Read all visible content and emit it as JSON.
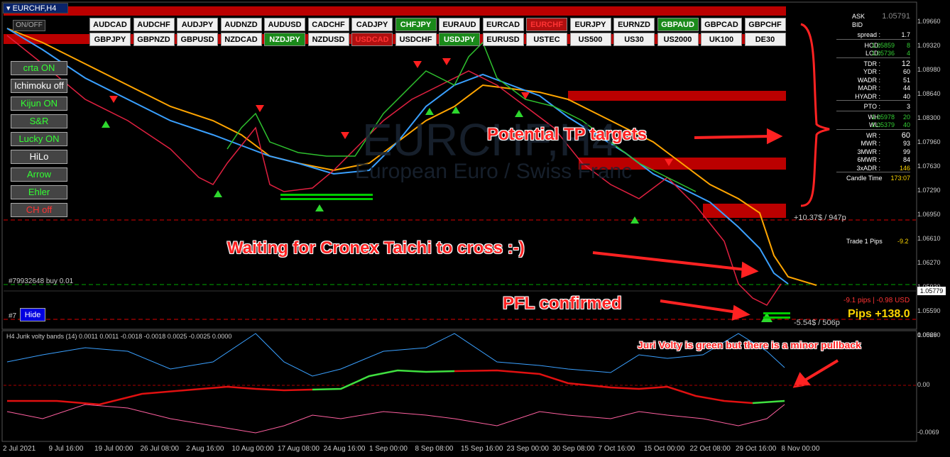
{
  "window": {
    "title": "EURCHF,H4",
    "onoff": "ON/OFF"
  },
  "symbols_row1": [
    {
      "label": "AUDCAD",
      "state": "normal"
    },
    {
      "label": "AUDCHF",
      "state": "normal"
    },
    {
      "label": "AUDJPY",
      "state": "normal"
    },
    {
      "label": "AUDNZD",
      "state": "normal"
    },
    {
      "label": "AUDUSD",
      "state": "normal"
    },
    {
      "label": "CADCHF",
      "state": "normal"
    },
    {
      "label": "CADJPY",
      "state": "normal"
    },
    {
      "label": "CHFJPY",
      "state": "green"
    },
    {
      "label": "EURAUD",
      "state": "normal"
    },
    {
      "label": "EURCAD",
      "state": "normal"
    },
    {
      "label": "EURCHF",
      "state": "red"
    },
    {
      "label": "EURJPY",
      "state": "normal"
    },
    {
      "label": "EURNZD",
      "state": "normal"
    },
    {
      "label": "GBPAUD",
      "state": "green"
    },
    {
      "label": "GBPCAD",
      "state": "normal"
    },
    {
      "label": "GBPCHF",
      "state": "normal"
    }
  ],
  "symbols_row2": [
    {
      "label": "GBPJPY",
      "state": "normal"
    },
    {
      "label": "GBPNZD",
      "state": "normal"
    },
    {
      "label": "GBPUSD",
      "state": "normal"
    },
    {
      "label": "NZDCAD",
      "state": "normal"
    },
    {
      "label": "NZDJPY",
      "state": "green"
    },
    {
      "label": "NZDUSD",
      "state": "normal"
    },
    {
      "label": "USDCAD",
      "state": "red"
    },
    {
      "label": "USDCHF",
      "state": "normal"
    },
    {
      "label": "USDJPY",
      "state": "green"
    },
    {
      "label": "EURUSD",
      "state": "normal"
    },
    {
      "label": "USTEC",
      "state": "normal"
    },
    {
      "label": "US500",
      "state": "normal"
    },
    {
      "label": "US30",
      "state": "normal"
    },
    {
      "label": "US2000",
      "state": "normal"
    },
    {
      "label": "UK100",
      "state": "normal"
    },
    {
      "label": "DE30",
      "state": "normal"
    }
  ],
  "side_buttons": [
    {
      "label": "crta ON",
      "style": "on"
    },
    {
      "label": "Ichimoku off",
      "style": "off"
    },
    {
      "label": "Kijun ON",
      "style": "on"
    },
    {
      "label": "S&R",
      "style": "on"
    },
    {
      "label": "Lucky ON",
      "style": "on"
    },
    {
      "label": "HiLo",
      "style": "off"
    },
    {
      "label": "Arrow",
      "style": "on"
    },
    {
      "label": "Ehler",
      "style": "on"
    },
    {
      "label": "CH off",
      "style": "red"
    }
  ],
  "hide_button": "Hide",
  "annotations": {
    "tp": "Potential TP targets",
    "waiting": "Waiting for Cronex Taichi to cross :-)",
    "pfl": "PFL confirmed",
    "juri": "Juri Volty is green but there is a minor pullback"
  },
  "chart_labels": {
    "trade_buy": "#79932648 buy 0.01",
    "trade_short": "#7",
    "tp_line": "+10.37$ / 947p",
    "sl_line": "-5.54$ / 506p",
    "pips_usd": "-9.1 pips | -0.98 USD",
    "pips_total": "Pips +138.0",
    "trade1": "Trade 1 Pips",
    "trade1_val": "-9.2",
    "current_price": "1.05779",
    "watermark_symbol": "EURCHF,H4",
    "watermark_desc": "European Euro / Swiss Franc"
  },
  "price_axis": [
    "1.09660",
    "1.09320",
    "1.08980",
    "1.08640",
    "1.08300",
    "1.07960",
    "1.07630",
    "1.07290",
    "1.06950",
    "1.06610",
    "1.06270",
    "1.05930",
    "1.05590",
    "1.05260"
  ],
  "indicator": {
    "title": "H4 Jurik volty bands (14) 0.0011 0.0011 -0.0018 -0.0018 0.0025 -0.0025 0.0000",
    "axis": [
      "0.0069",
      "0.00",
      "-0.0069"
    ]
  },
  "time_axis": [
    "2 Jul 2021",
    "9 Jul 16:00",
    "19 Jul 00:00",
    "26 Jul 08:00",
    "2 Aug 16:00",
    "10 Aug 00:00",
    "17 Aug 08:00",
    "24 Aug 16:00",
    "1 Sep 00:00",
    "8 Sep 08:00",
    "15 Sep 16:00",
    "23 Sep 00:00",
    "30 Sep 08:00",
    "7 Oct 16:00",
    "15 Oct 00:00",
    "22 Oct 08:00",
    "29 Oct 16:00",
    "8 Nov 00:00"
  ],
  "info_panel": {
    "ask_label": "ASK",
    "ask": "1.05791",
    "bid_label": "BID",
    "bid": "",
    "rows": [
      {
        "k": "spread :",
        "v": "1.7"
      },
      {
        "k": "HOD:",
        "v": "1.05859",
        "extra": "8",
        "green": true
      },
      {
        "k": "LOD:",
        "v": "1.05736",
        "extra": "4",
        "green": true
      },
      {
        "k": "TDR :",
        "v": "12"
      },
      {
        "k": "YDR :",
        "v": "60"
      },
      {
        "k": "WADR :",
        "v": "51"
      },
      {
        "k": "MADR :",
        "v": "44"
      },
      {
        "k": "HYADR :",
        "v": "40"
      },
      {
        "k": "PTO :",
        "v": "3"
      },
      {
        "k": "WH:",
        "v": "1.05978",
        "extra": "20",
        "green": true
      },
      {
        "k": "WL:",
        "v": "1.05379",
        "extra": "40",
        "green": true
      },
      {
        "k": "WR :",
        "v": "60"
      },
      {
        "k": "MWR :",
        "v": "93"
      },
      {
        "k": "3MWR :",
        "v": "99"
      },
      {
        "k": "6MWR :",
        "v": "84"
      },
      {
        "k": "3xADR :",
        "v": "146",
        "yellow": true
      },
      {
        "k": "Candle Time",
        "v": "173:07",
        "yellow": true
      }
    ]
  },
  "colors": {
    "accent_red": "#e81010",
    "green": "#1a8a1a",
    "yellow": "#ffd700",
    "blue": "#3aa0ff",
    "orange": "#ffa500"
  }
}
